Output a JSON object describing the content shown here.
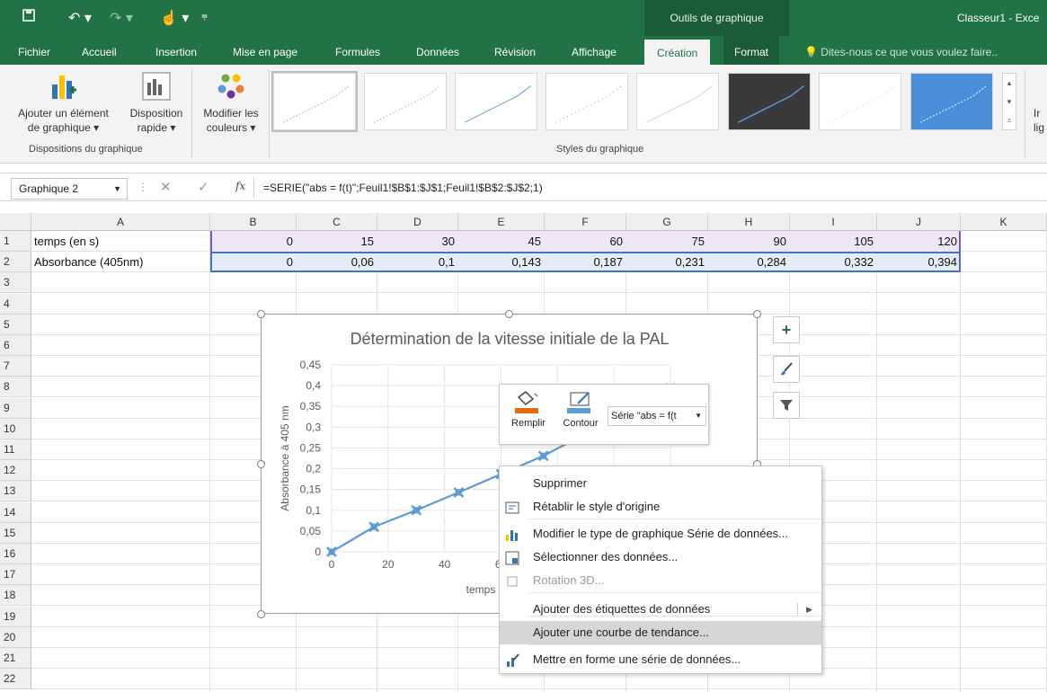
{
  "app": {
    "doc_title": "Classeur1 - Exce",
    "contextual_group": "Outils de graphique",
    "tell_me": "Dites-nous ce que vous voulez faire.."
  },
  "tabs": [
    "Fichier",
    "Accueil",
    "Insertion",
    "Mise en page",
    "Formules",
    "Données",
    "Révision",
    "Affichage",
    "Création",
    "Format"
  ],
  "ribbon": {
    "add_element": [
      "Ajouter un élément",
      "de graphique ▾"
    ],
    "quick_layout": [
      "Disposition",
      "rapide ▾"
    ],
    "change_colors": [
      "Modifier les",
      "couleurs ▾"
    ],
    "group_layouts": "Dispositions du graphique",
    "group_styles": "Styles du graphique",
    "cut_right": [
      "Ir",
      "lig"
    ]
  },
  "formula_bar": {
    "name_box": "Graphique 2",
    "fx": "fx",
    "formula": "=SERIE(\"abs = f(t)\";Feuil1!$B$1:$J$1;Feuil1!$B$2:$J$2;1)"
  },
  "sheet": {
    "columns": [
      "A",
      "B",
      "C",
      "D",
      "E",
      "F",
      "G",
      "H",
      "I",
      "J",
      "K"
    ],
    "rows": [
      "1",
      "2",
      "3",
      "4",
      "5",
      "6",
      "7",
      "8",
      "9",
      "10",
      "11",
      "12",
      "13",
      "14",
      "15",
      "16",
      "17",
      "18",
      "19",
      "20",
      "21",
      "22"
    ],
    "row1_label": "temps (en s)",
    "row1_values": [
      "0",
      "15",
      "30",
      "45",
      "60",
      "75",
      "90",
      "105",
      "120"
    ],
    "row2_label": "Absorbance (405nm)",
    "row2_values": [
      "0",
      "0,06",
      "0,1",
      "0,143",
      "0,187",
      "0,231",
      "0,284",
      "0,332",
      "0,394"
    ]
  },
  "chart_data": {
    "type": "line",
    "title": "Détermination de la vitesse initiale de la PAL",
    "ylabel": "Absorbance à 405 nm",
    "xlabel": "temps",
    "x": [
      0,
      15,
      30,
      45,
      60,
      75,
      90,
      105,
      120
    ],
    "series": [
      {
        "name": "abs = f(t)",
        "values": [
          0,
          0.06,
          0.1,
          0.143,
          0.187,
          0.231,
          0.284,
          0.332,
          0.394
        ],
        "color": "#5b9bd5"
      }
    ],
    "xlim": [
      0,
      120
    ],
    "ylim": [
      0,
      0.45
    ],
    "xticks_visible": [
      "0",
      "20",
      "40",
      "60"
    ],
    "yticks": [
      "0,45",
      "0,4",
      "0,35",
      "0,3",
      "0,25",
      "0,2",
      "0,15",
      "0,1",
      "0,05",
      "0"
    ],
    "grid": true
  },
  "mini_toolbar": {
    "fill": "Remplir",
    "outline": "Contour",
    "series_select": "Série \"abs = f(t"
  },
  "context_menu": [
    {
      "label": "Supprimer",
      "icon": "",
      "disabled": false
    },
    {
      "label": "Rétablir le style d'origine",
      "icon": "reset-style-icon",
      "disabled": false
    },
    {
      "label": "Modifier le type de graphique Série de données...",
      "icon": "chart-type-icon",
      "disabled": false
    },
    {
      "label": "Sélectionner des données...",
      "icon": "select-data-icon",
      "disabled": false
    },
    {
      "label": "Rotation 3D...",
      "icon": "rotation-3d-icon",
      "disabled": true
    },
    {
      "label": "Ajouter des étiquettes de données",
      "icon": "",
      "disabled": false,
      "submenu": true
    },
    {
      "label": "Ajouter une courbe de tendance...",
      "icon": "",
      "disabled": false,
      "highlighted": true
    },
    {
      "label": "Mettre en forme une série de données...",
      "icon": "format-series-icon",
      "disabled": false
    }
  ],
  "colors": {
    "excel_green": "#217346",
    "series_blue": "#5b9bd5",
    "fill_orange": "#e46c0a"
  }
}
